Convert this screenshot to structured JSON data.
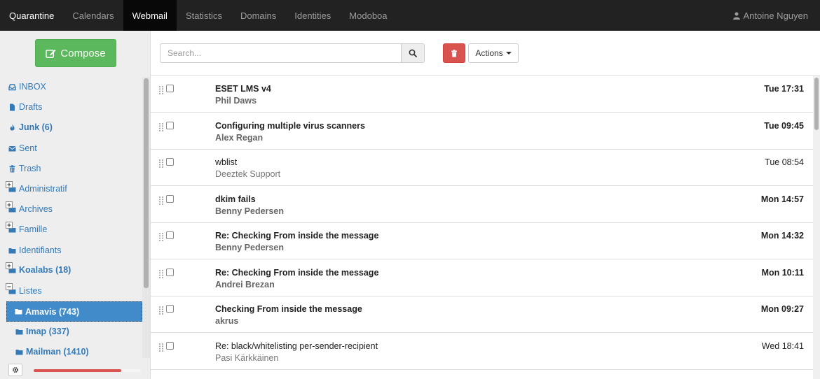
{
  "navbar": {
    "items": [
      {
        "label": "Quarantine"
      },
      {
        "label": "Calendars"
      },
      {
        "label": "Webmail"
      },
      {
        "label": "Statistics"
      },
      {
        "label": "Domains"
      },
      {
        "label": "Identities"
      },
      {
        "label": "Modoboa"
      }
    ],
    "active": "Webmail",
    "user": "Antoine Nguyen"
  },
  "sidebar": {
    "compose_label": "Compose",
    "folders": [
      {
        "label": "INBOX",
        "icon": "inbox-icon"
      },
      {
        "label": "Drafts",
        "icon": "file-icon"
      },
      {
        "label": "Junk (6)",
        "icon": "fire-icon",
        "bold": true
      },
      {
        "label": "Sent",
        "icon": "envelope-icon"
      },
      {
        "label": "Trash",
        "icon": "trash-icon"
      },
      {
        "label": "Administratif",
        "icon": "folder-icon",
        "expandable": true
      },
      {
        "label": "Archives",
        "icon": "folder-icon",
        "expandable": true
      },
      {
        "label": "Famille",
        "icon": "folder-icon",
        "expandable": true
      },
      {
        "label": "Identifiants",
        "icon": "folder-icon"
      },
      {
        "label": "Koalabs (18)",
        "icon": "folder-icon",
        "expandable": true,
        "bold": true
      },
      {
        "label": "Listes",
        "icon": "folder-open-icon",
        "expanded": true
      },
      {
        "label": "Amavis (743)",
        "icon": "folder-icon",
        "child": true,
        "bold": true,
        "selected": true
      },
      {
        "label": "Imap (337)",
        "icon": "folder-icon",
        "child": true,
        "bold": true
      },
      {
        "label": "Mailman (1410)",
        "icon": "folder-icon",
        "child": true,
        "bold": true
      }
    ],
    "quota_fraction": 0.82
  },
  "toolbar": {
    "search_placeholder": "Search...",
    "actions_label": "Actions"
  },
  "messages": [
    {
      "subject": "ESET LMS v4",
      "sender": "Phil Daws",
      "date": "Tue 17:31",
      "unread": true
    },
    {
      "subject": "Configuring multiple virus scanners",
      "sender": "Alex Regan",
      "date": "Tue 09:45",
      "unread": true
    },
    {
      "subject": "wblist",
      "sender": "Deeztek Support",
      "date": "Tue 08:54",
      "unread": false
    },
    {
      "subject": "dkim fails",
      "sender": "Benny Pedersen",
      "date": "Mon 14:57",
      "unread": true
    },
    {
      "subject": "Re: Checking From inside the message",
      "sender": "Benny Pedersen",
      "date": "Mon 14:32",
      "unread": true
    },
    {
      "subject": "Re: Checking From inside the message",
      "sender": "Andrei Brezan",
      "date": "Mon 10:11",
      "unread": true
    },
    {
      "subject": "Checking From inside the message",
      "sender": "akrus",
      "date": "Mon 09:27",
      "unread": true
    },
    {
      "subject": "Re: black/whitelisting per-sender-recipient",
      "sender": "Pasi Kärkkäinen",
      "date": "Wed 18:41",
      "unread": false
    }
  ],
  "colors": {
    "navbar_bg": "#222222",
    "link": "#337ab7",
    "compose": "#5cb85c",
    "danger": "#d9534f",
    "selected_folder": "#428bca"
  }
}
